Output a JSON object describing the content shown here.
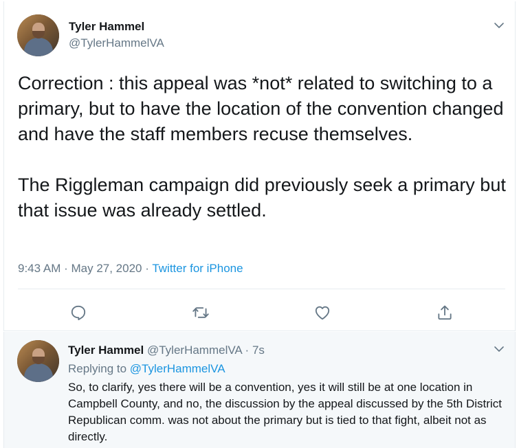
{
  "main_tweet": {
    "author_name": "Tyler Hammel",
    "author_handle": "@TylerHammelVA",
    "text": "Correction : this appeal was *not* related to switching to a primary, but to have the location of the convention changed and have the staff members recuse themselves.\n\nThe Riggleman campaign did previously seek a primary but that issue was already settled.",
    "time": "9:43 AM",
    "separator1": " · ",
    "date": "May 27, 2020",
    "separator2": " · ",
    "source": "Twitter for iPhone",
    "actions": [
      "reply-icon",
      "retweet-icon",
      "like-icon",
      "share-icon"
    ],
    "link_color": "#1b95e0"
  },
  "reply_tweet": {
    "author_name": "Tyler Hammel",
    "author_handle": "@TylerHammelVA",
    "dot": " · ",
    "time_ago": "7s",
    "replying_prefix": "Replying to ",
    "replying_to": "@TylerHammelVA",
    "text": "So, to clarify, yes there will be a convention, yes it will still be at one location in Campbell County, and no, the discussion by the appeal discussed by the 5th District Republican comm. was not about the primary but is tied to that fight, albeit not as directly."
  }
}
